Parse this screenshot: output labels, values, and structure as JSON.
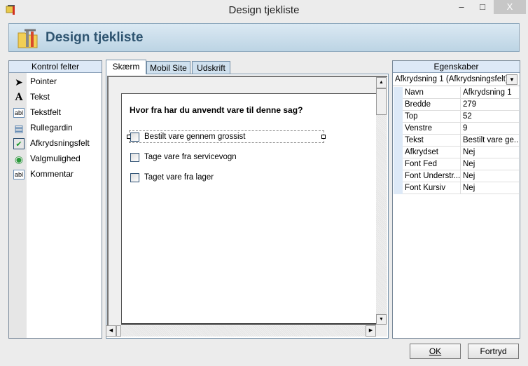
{
  "window": {
    "title": "Design tjekliste",
    "minimize": "–",
    "maximize": "□",
    "close": "X"
  },
  "banner": {
    "title": "Design tjekliste"
  },
  "controls": {
    "header": "Kontrol felter",
    "items": [
      {
        "label": "Pointer",
        "icon": "pointer-icon",
        "glyph": "➤"
      },
      {
        "label": "Tekst",
        "icon": "text-icon",
        "glyph": "A"
      },
      {
        "label": "Tekstfelt",
        "icon": "textfield-icon",
        "glyph": "abl"
      },
      {
        "label": "Rullegardin",
        "icon": "dropdown-icon",
        "glyph": "▤"
      },
      {
        "label": "Afkrydsningsfelt",
        "icon": "checkbox-icon",
        "glyph": "✔"
      },
      {
        "label": "Valgmulighed",
        "icon": "radio-icon",
        "glyph": "◉"
      },
      {
        "label": "Kommentar",
        "icon": "comment-icon",
        "glyph": "abl"
      }
    ]
  },
  "tabs": [
    {
      "label": "Skærm",
      "active": true
    },
    {
      "label": "Mobil Site"
    },
    {
      "label": "Udskrift"
    }
  ],
  "form": {
    "question": "Hvor fra har du anvendt vare til denne sag?",
    "options": [
      {
        "label": "Bestilt vare gennem grossist",
        "selected": true
      },
      {
        "label": "Tage vare fra servicevogn"
      },
      {
        "label": "Taget vare fra lager"
      }
    ]
  },
  "properties": {
    "header": "Egenskaber",
    "selected": "Afkrydsning 1 (Afkrydsningsfelt)",
    "rows": [
      {
        "k": "Navn",
        "v": "Afkrydsning 1"
      },
      {
        "k": "Bredde",
        "v": "279"
      },
      {
        "k": "Top",
        "v": "52"
      },
      {
        "k": "Venstre",
        "v": "9"
      },
      {
        "k": "Tekst",
        "v": "Bestilt vare ge..."
      },
      {
        "k": "Afkrydset",
        "v": "Nej"
      },
      {
        "k": "Font Fed",
        "v": "Nej"
      },
      {
        "k": "Font Understr...",
        "v": "Nej"
      },
      {
        "k": "Font Kursiv",
        "v": "Nej"
      }
    ]
  },
  "buttons": {
    "ok": "OK",
    "cancel": "Fortryd"
  }
}
